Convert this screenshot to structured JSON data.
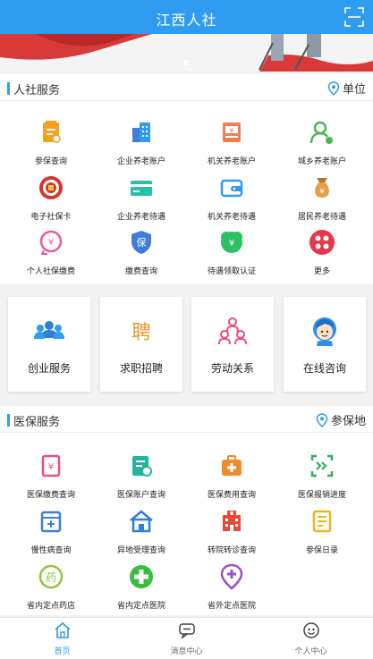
{
  "header": {
    "title": "江西人社"
  },
  "social": {
    "title": "人社服务",
    "location_label": "单位",
    "items": [
      {
        "label": "参保查询",
        "icon": "insurance-query-icon"
      },
      {
        "label": "企业养老账户",
        "icon": "enterprise-pension-account-icon"
      },
      {
        "label": "机关养老账户",
        "icon": "institution-pension-account-icon"
      },
      {
        "label": "城乡养老账户",
        "icon": "urban-rural-pension-account-icon"
      },
      {
        "label": "电子社保卡",
        "icon": "e-social-card-icon"
      },
      {
        "label": "企业养老待遇",
        "icon": "enterprise-pension-benefit-icon"
      },
      {
        "label": "机关养老待遇",
        "icon": "institution-pension-benefit-icon"
      },
      {
        "label": "居民养老待遇",
        "icon": "resident-pension-benefit-icon"
      },
      {
        "label": "个人社保缴费",
        "icon": "personal-payment-icon"
      },
      {
        "label": "缴费查询",
        "icon": "payment-query-icon"
      },
      {
        "label": "待遇领取认证",
        "icon": "benefit-certification-icon"
      },
      {
        "label": "更多",
        "icon": "more-icon"
      }
    ]
  },
  "cards": [
    {
      "label": "创业服务",
      "icon": "entrepreneurship-icon"
    },
    {
      "label": "求职招聘",
      "icon": "recruitment-icon"
    },
    {
      "label": "劳动关系",
      "icon": "labor-relations-icon"
    },
    {
      "label": "在线咨询",
      "icon": "online-consult-icon"
    }
  ],
  "medical": {
    "title": "医保服务",
    "location_label": "参保地",
    "items": [
      {
        "label": "医保缴费查询",
        "icon": "medical-payment-query-icon"
      },
      {
        "label": "医保账户查询",
        "icon": "medical-account-query-icon"
      },
      {
        "label": "医保费用查询",
        "icon": "medical-cost-query-icon"
      },
      {
        "label": "医保报销进度",
        "icon": "reimbursement-progress-icon"
      },
      {
        "label": "慢性病查询",
        "icon": "chronic-disease-query-icon"
      },
      {
        "label": "异地受理查询",
        "icon": "remote-acceptance-query-icon"
      },
      {
        "label": "转院转诊查询",
        "icon": "hospital-transfer-query-icon"
      },
      {
        "label": "参保日录",
        "icon": "insurance-directory-icon"
      },
      {
        "label": "省内定点药店",
        "icon": "pharmacy-icon"
      },
      {
        "label": "省内定点医院",
        "icon": "in-province-hospital-icon"
      },
      {
        "label": "省外定点医院",
        "icon": "out-province-hospital-icon"
      }
    ]
  },
  "tabs": [
    {
      "label": "首页",
      "icon": "home-icon",
      "active": true
    },
    {
      "label": "消息中心",
      "icon": "message-icon",
      "active": false
    },
    {
      "label": "个人中心",
      "icon": "profile-icon",
      "active": false
    }
  ],
  "colors": {
    "primary": "#2f9cf0",
    "banner_red": "#d83a3a"
  }
}
